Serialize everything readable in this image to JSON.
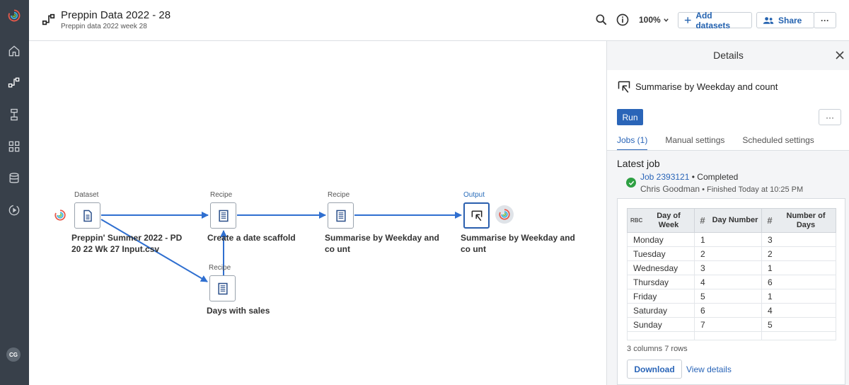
{
  "header": {
    "title": "Preppin Data 2022 - 28",
    "subtitle": "Preppin data 2022 week 28",
    "zoom": "100%",
    "add_datasets_label": "Add datasets",
    "share_label": "Share",
    "more_label": "···"
  },
  "sidebar": {
    "avatar_initials": "CG"
  },
  "flow": {
    "nodes": [
      {
        "type_label": "Dataset",
        "name": "Preppin' Summer 2022 - PD 20 22 Wk 27 Input.csv"
      },
      {
        "type_label": "Recipe",
        "name": "Create a date scaffold"
      },
      {
        "type_label": "Recipe",
        "name": "Summarise by Weekday and co unt"
      },
      {
        "type_label": "Output",
        "name": "Summarise by Weekday and co unt"
      },
      {
        "type_label": "Recipe",
        "name": "Days with sales"
      }
    ]
  },
  "details": {
    "title": "Details",
    "recipe_name": "Summarise by Weekday and count",
    "run_label": "Run",
    "more_label": "···",
    "tabs": [
      {
        "label": "Jobs (1)",
        "active": true
      },
      {
        "label": "Manual settings",
        "active": false
      },
      {
        "label": "Scheduled settings",
        "active": false
      }
    ],
    "latest_job_label": "Latest job",
    "job_link": "Job 2393121",
    "job_status": "• Completed",
    "job_user": "Chris Goodman",
    "job_finished": "• Finished Today at 10:25 PM",
    "status_color": "#2ea043"
  },
  "results": {
    "columns": [
      {
        "type": "RBC",
        "name": "Day of Week"
      },
      {
        "type": "#",
        "name": "Day Number"
      },
      {
        "type": "#",
        "name": "Number of Days"
      }
    ],
    "rows": [
      [
        "Monday",
        "1",
        "3"
      ],
      [
        "Tuesday",
        "2",
        "2"
      ],
      [
        "Wednesday",
        "3",
        "1"
      ],
      [
        "Thursday",
        "4",
        "6"
      ],
      [
        "Friday",
        "5",
        "1"
      ],
      [
        "Saturday",
        "6",
        "4"
      ],
      [
        "Sunday",
        "7",
        "5"
      ]
    ],
    "summary_columns": "3",
    "summary_columns_label": "columns",
    "summary_rows": "7",
    "summary_rows_label": "rows",
    "download_label": "Download",
    "view_details_label": "View details"
  },
  "colors": {
    "rail": "#38404a",
    "accent": "#2a65b8",
    "edge": "#2f6fd0"
  }
}
